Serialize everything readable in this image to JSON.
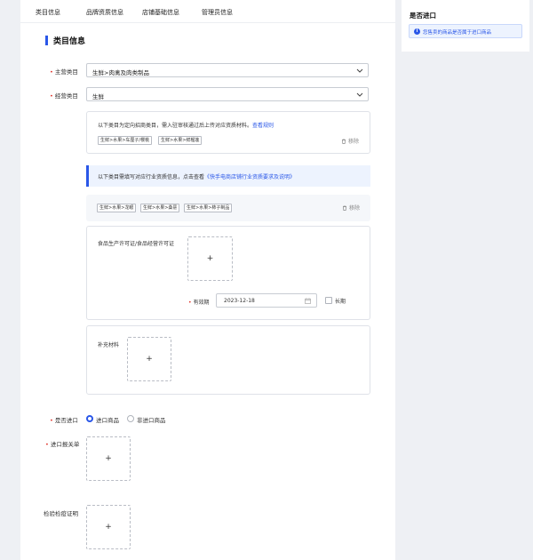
{
  "tabs": [
    "类目信息",
    "品牌资质信息",
    "店铺基础信息",
    "管理员信息"
  ],
  "section_title": "类目信息",
  "main_category": {
    "label": "主营类目",
    "value": "生鲜>肉禽及肉类制品"
  },
  "business_category": {
    "label": "经营类目",
    "value": "生鲜"
  },
  "notice_box": {
    "text": "以下类目为定向招商类目，需入驻审核通过后上传对应资质材料。",
    "link": "查看规则",
    "tags": [
      "生鲜>水果>车厘子/樱桃",
      "生鲜>水果>鲜榴莲"
    ],
    "remove_label": "移除"
  },
  "info_bar": {
    "text": "以下类目需填写对应行业资质信息，点击查看",
    "link": "《快手电商店铺行业资质要求及说明》"
  },
  "qual_box": {
    "tags": [
      "生鲜>水果>龙眼",
      "生鲜>水果>桑葚",
      "生鲜>水果>柿子制品"
    ],
    "remove_label": "移除",
    "license_label": "食品生产许可证/食品经营许可证",
    "validity_label": "有效期",
    "validity_value": "2023-12-18",
    "longterm_label": "长期",
    "supplement_label": "补充材料"
  },
  "import": {
    "label": "是否进口",
    "options": [
      "进口商品",
      "非进口商品"
    ],
    "selected": "进口商品"
  },
  "import_declaration_label": "进口报关单",
  "inspection_label": "检验检疫证明",
  "upload_plus": "+",
  "side_panel": {
    "title": "是否进口",
    "notice": "您售卖的商品是否属于进口商品"
  }
}
